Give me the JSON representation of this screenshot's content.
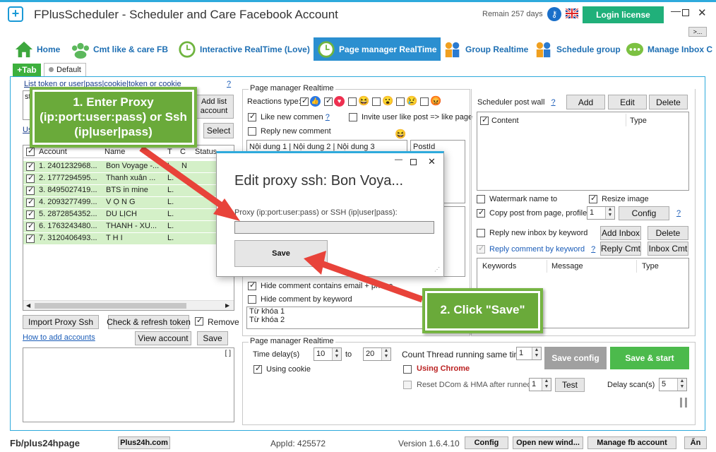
{
  "window": {
    "title": "FPlusScheduler - Scheduler and Care Facebook Account",
    "remain": "Remain 257 days",
    "login": "Login license",
    "more": ">..."
  },
  "tabs": [
    {
      "label": "Home"
    },
    {
      "label": "Cmt like & care FB"
    },
    {
      "label": "Interactive RealTime (Love)"
    },
    {
      "label": "Page manager RealTime"
    },
    {
      "label": "Group Realtime"
    },
    {
      "label": "Schedule group"
    },
    {
      "label": "Manage Inbox C"
    }
  ],
  "subtabs": {
    "add": "+Tab",
    "default": "Default"
  },
  "left": {
    "list_token_label": "List token or user|pass|cookie|token or cookie",
    "help": "?",
    "token_value": "st",
    "add_list_btn": "Add list account",
    "user_label": "Us",
    "select_btn": "Select",
    "columns": [
      "Account",
      "Name",
      "T",
      "C",
      "Status"
    ],
    "rows": [
      {
        "account": "1. 2401232968...",
        "name": "Bon Voyage -...",
        "t": "L.",
        "c": "N"
      },
      {
        "account": "2. 1777294595...",
        "name": "Thanh xuân ...",
        "t": "L.",
        "c": ""
      },
      {
        "account": "3. 8495027419...",
        "name": "BTS in mine",
        "t": "L.",
        "c": ""
      },
      {
        "account": "4. 2093277499...",
        "name": "V Ọ N G",
        "t": "L.",
        "c": ""
      },
      {
        "account": "5. 2872854352...",
        "name": "DU LỊCH",
        "t": "L.",
        "c": ""
      },
      {
        "account": "6. 1763243480...",
        "name": "THANH - XU...",
        "t": "L.",
        "c": ""
      },
      {
        "account": "7. 3120406493...",
        "name": "T H I",
        "t": "L.",
        "c": ""
      }
    ],
    "import_proxy_btn": "Import Proxy Ssh",
    "check_token_btn": "Check & refresh token",
    "remove_label": "Remove",
    "how_to_link": "How to add accounts",
    "view_account_btn": "View account",
    "save_btn": "Save",
    "log_corner": "[ ]"
  },
  "page_manager": {
    "group_title": "Page manager Realtime",
    "reactions_label": "Reactions type:",
    "like_new_comment": "Like new commen",
    "invite_label": "Invite user like post => like page",
    "reply_new_comment": "Reply new comment",
    "content_text": "Nội dung 1 | Nội dung 2 | Nội dung 3",
    "postid_label": "PostId",
    "hide_email": "Hide comment contains email + phone",
    "hide_keyword": "Hide comment by keyword",
    "keywords": [
      "Từ khóa 1",
      "Từ khóa 2"
    ]
  },
  "scheduler": {
    "label": "Scheduler post wall",
    "help": "?",
    "add_btn": "Add",
    "edit_btn": "Edit",
    "delete_btn": "Delete",
    "columns": [
      "Content",
      "Type"
    ],
    "watermark": "Watermark name to",
    "resize": "Resize image",
    "copy_post": "Copy post from page, profile,",
    "copy_value": "1",
    "config_btn": "Config",
    "reply_inbox": "Reply new inbox by keyword",
    "add_inbox_btn": "Add Inbox",
    "delete_btn2": "Delete",
    "reply_comment": "Reply comment by keyword",
    "reply_cmt_btn": "Reply Cmt",
    "inbox_cmt_btn": "Inbox Cmt",
    "kw_columns": [
      "Keywords",
      "Message",
      "Type"
    ]
  },
  "realtime": {
    "group_title": "Page manager Realtime",
    "time_delay": "Time delay(s)",
    "delay_from": "10",
    "to": "to",
    "delay_to": "20",
    "using_cookie": "Using cookie",
    "thread_label": "Count Thread running same time",
    "thread_value": "1",
    "using_chrome": "Using Chrome",
    "reset_label": "Reset DCom & HMA after runned",
    "reset_value": "1",
    "test_btn": "Test",
    "save_config_btn": "Save config",
    "save_start_btn": "Save & start",
    "delay_scan": "Delay scan(s)",
    "delay_scan_value": "5"
  },
  "dialog": {
    "title": "Edit proxy ssh: Bon Voya...",
    "field_label": "Proxy (ip:port:user:pass) or SSH (ip|user|pass):",
    "field_value": "",
    "save_btn": "Save"
  },
  "annotations": {
    "step1": "1. Enter Proxy (ip:port:user:pass) or Ssh (ip|user|pass)",
    "step2": "2. Click \"Save\""
  },
  "statusbar": {
    "fb": "Fb/plus24hpage",
    "site": "Plus24h.com",
    "appid": "AppId: 425572",
    "version": "Version 1.6.4.10",
    "config_btn": "Config",
    "open_new_btn": "Open new wind...",
    "manage_btn": "Manage fb account",
    "lang_btn": "Ẩn"
  },
  "colors": {
    "accent": "#2eaadc",
    "login_bg": "#20b07a",
    "save_start": "#4cba4c",
    "save_config": "#a0a0a0",
    "annotation_border": "#77b543",
    "arrow": "#e8433a",
    "row_green": "#d4f0c8"
  }
}
